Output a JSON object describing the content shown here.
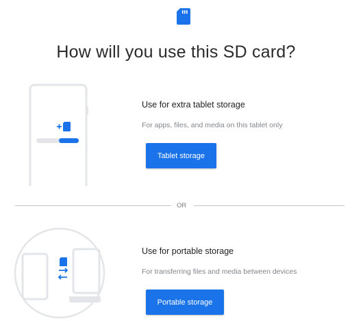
{
  "header": {
    "title": "How will you use this SD card?",
    "icon": "sd-card-icon"
  },
  "options": [
    {
      "title": "Use for extra tablet storage",
      "description": "For apps, files, and media on this tablet only",
      "button_label": "Tablet storage",
      "illustration": "tablet-storage-illustration"
    },
    {
      "title": "Use for portable storage",
      "description": "For transferring files and media between devices",
      "button_label": "Portable storage",
      "illustration": "portable-storage-illustration"
    }
  ],
  "divider": {
    "label": "OR"
  },
  "colors": {
    "accent": "#1a73e8",
    "illustration_line": "#e3e5e8",
    "text_secondary": "#80868b"
  }
}
